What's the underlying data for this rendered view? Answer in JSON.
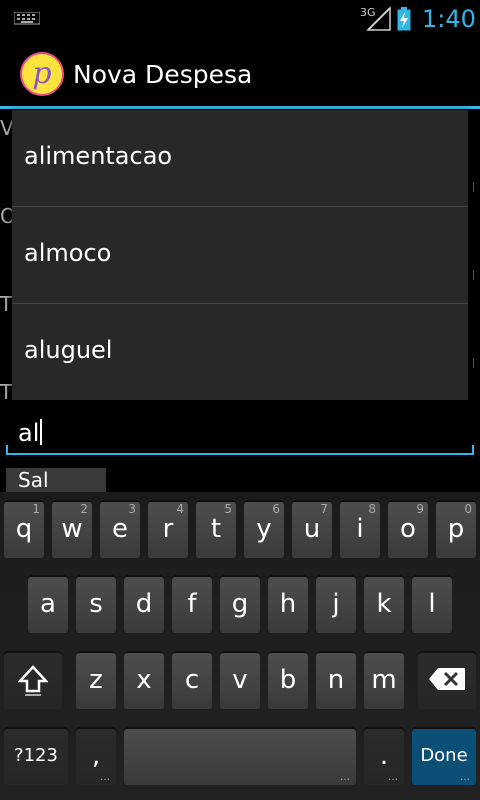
{
  "status_bar": {
    "network": "3G",
    "time": "1:40",
    "accent_color": "#33b5e5"
  },
  "action_bar": {
    "app_icon_letter": "p",
    "title": "Nova Despesa"
  },
  "form": {
    "partial_labels": [
      "V",
      "O",
      "T",
      "T"
    ],
    "input_value": "al",
    "save_button_partial": "Sal"
  },
  "dropdown": {
    "items": [
      "alimentacao",
      "almoco",
      "aluguel"
    ]
  },
  "keyboard": {
    "row1": [
      {
        "key": "q",
        "hint": "1"
      },
      {
        "key": "w",
        "hint": "2"
      },
      {
        "key": "e",
        "hint": "3"
      },
      {
        "key": "r",
        "hint": "4"
      },
      {
        "key": "t",
        "hint": "5"
      },
      {
        "key": "y",
        "hint": "6"
      },
      {
        "key": "u",
        "hint": "7"
      },
      {
        "key": "i",
        "hint": "8"
      },
      {
        "key": "o",
        "hint": "9"
      },
      {
        "key": "p",
        "hint": "0"
      }
    ],
    "row2": [
      "a",
      "s",
      "d",
      "f",
      "g",
      "h",
      "j",
      "k",
      "l"
    ],
    "row3": [
      "z",
      "x",
      "c",
      "v",
      "b",
      "n",
      "m"
    ],
    "symbols_label": "?123",
    "comma_label": ",",
    "period_label": ".",
    "done_label": "Done"
  }
}
